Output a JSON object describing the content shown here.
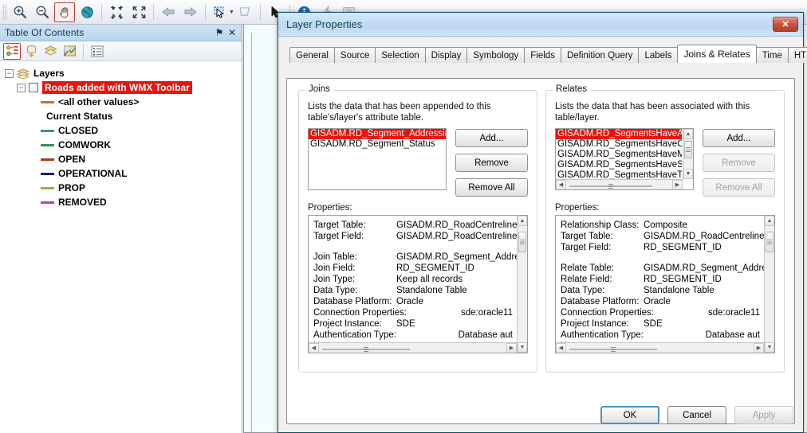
{
  "toolbar": {
    "buttons": [
      {
        "name": "zoom-in-icon",
        "label": "Zoom In",
        "active": false
      },
      {
        "name": "zoom-out-icon",
        "label": "Zoom Out",
        "active": false
      },
      {
        "name": "pan-hand-icon",
        "label": "Pan",
        "active": true
      },
      {
        "name": "full-extent-globe-icon",
        "label": "Full Extent",
        "active": false
      },
      {
        "name": "fixed-zoom-in-icon",
        "label": "Fixed Zoom In",
        "active": false
      },
      {
        "name": "fixed-zoom-out-icon",
        "label": "Fixed Zoom Out",
        "active": false
      },
      {
        "name": "back-extent-arrow-icon",
        "label": "Go Back To Previous Extent",
        "active": false
      },
      {
        "name": "forward-extent-arrow-icon",
        "label": "Go To Next Extent",
        "active": false
      },
      {
        "name": "select-features-icon",
        "label": "Select Features",
        "active": false
      },
      {
        "name": "clear-selection-icon",
        "label": "Clear Selected Features",
        "active": false
      },
      {
        "name": "select-elements-arrow-icon",
        "label": "Select Elements",
        "active": false
      },
      {
        "name": "identify-info-icon",
        "label": "Identify",
        "active": false
      },
      {
        "name": "hyperlink-lightning-icon",
        "label": "Hyperlink",
        "active": false
      },
      {
        "name": "html-popup-icon",
        "label": "HTML Popup",
        "active": false
      }
    ]
  },
  "toc": {
    "title": "Table Of Contents",
    "pin_icon": "⚑",
    "close_icon": "✕",
    "tools": [
      {
        "name": "list-by-drawing-order-icon",
        "selected": true
      },
      {
        "name": "list-by-source-icon",
        "selected": false
      },
      {
        "name": "list-by-visibility-icon",
        "selected": false
      },
      {
        "name": "list-by-selection-icon",
        "selected": false
      },
      {
        "name": "options-icon",
        "selected": false
      }
    ],
    "root": "Layers",
    "layer": "Roads added with WMX Toolbar",
    "legend": [
      {
        "label": "<all other values>",
        "color": "#c8761a",
        "type": "line"
      },
      {
        "label": "Current Status",
        "color": "",
        "type": "heading"
      },
      {
        "label": "CLOSED",
        "color": "#3e8a9c",
        "type": "line"
      },
      {
        "label": "COMWORK",
        "color": "#2f8f63",
        "type": "line"
      },
      {
        "label": "OPEN",
        "color": "#a23c21",
        "type": "line"
      },
      {
        "label": "OPERATIONAL",
        "color": "#17246e",
        "type": "line"
      },
      {
        "label": "PROP",
        "color": "#97b628",
        "type": "line"
      },
      {
        "label": "REMOVED",
        "color": "#b440b8",
        "type": "line"
      }
    ]
  },
  "dialog": {
    "title": "Layer Properties",
    "close_label": "✕",
    "tabs": [
      {
        "label": "General",
        "active": false
      },
      {
        "label": "Source",
        "active": false
      },
      {
        "label": "Selection",
        "active": false
      },
      {
        "label": "Display",
        "active": false
      },
      {
        "label": "Symbology",
        "active": false
      },
      {
        "label": "Fields",
        "active": false
      },
      {
        "label": "Definition Query",
        "active": false
      },
      {
        "label": "Labels",
        "active": false
      },
      {
        "label": "Joins & Relates",
        "active": true
      },
      {
        "label": "Time",
        "active": false
      },
      {
        "label": "HTML Popup",
        "active": false
      }
    ],
    "joins": {
      "legend": "Joins",
      "description": "Lists the data that has been appended to this table's/layer's attribute table.",
      "items": [
        {
          "label": "GISADM.RD_Segment_Addressing",
          "selected": true
        },
        {
          "label": "GISADM.RD_Segment_Status",
          "selected": false
        }
      ],
      "buttons": [
        {
          "label": "Add...",
          "name": "add-join-button",
          "disabled": false
        },
        {
          "label": "Remove",
          "name": "remove-join-button",
          "disabled": false
        },
        {
          "label": "Remove All",
          "name": "remove-all-joins-button",
          "disabled": false
        }
      ],
      "properties_label": "Properties:",
      "properties": [
        {
          "key": "Target Table:",
          "value": "GISADM.RD_RoadCentrelines",
          "align": "left"
        },
        {
          "key": "Target Field:",
          "value": "GISADM.RD_RoadCentrelines.RD",
          "align": "left"
        },
        {
          "key": "",
          "value": "",
          "align": "gap"
        },
        {
          "key": "Join Table:",
          "value": "GISADM.RD_Segment_Addressing",
          "align": "left"
        },
        {
          "key": "Join Field:",
          "value": "RD_SEGMENT_ID",
          "align": "left"
        },
        {
          "key": "Join Type:",
          "value": "Keep all records",
          "align": "left"
        },
        {
          "key": "Data Type:",
          "value": "Standalone Table",
          "align": "left"
        },
        {
          "key": "Database Platform:",
          "value": "Oracle",
          "align": "left"
        },
        {
          "key": "Connection Properties:",
          "value": "sde:oracle11",
          "align": "right"
        },
        {
          "key": "Project Instance:",
          "value": "SDE",
          "align": "left"
        },
        {
          "key": "Authentication Type:",
          "value": "Database aut",
          "align": "right"
        },
        {
          "key": "User name:",
          "value": "",
          "align": "left"
        }
      ]
    },
    "relates": {
      "legend": "Relates",
      "description": "Lists the data that has been associated with this table/layer.",
      "items": [
        {
          "label": "GISADM.RD_SegmentsHaveAddres",
          "selected": true
        },
        {
          "label": "GISADM.RD_SegmentsHaveClassif",
          "selected": false
        },
        {
          "label": "GISADM.RD_SegmentsHaveMaintC",
          "selected": false
        },
        {
          "label": "GISADM.RD_SegmentsHaveStatus",
          "selected": false
        },
        {
          "label": "GISADM.RD_SegmentsHaveTruckR",
          "selected": false
        }
      ],
      "buttons": [
        {
          "label": "Add...",
          "name": "add-relate-button",
          "disabled": false
        },
        {
          "label": "Remove",
          "name": "remove-relate-button",
          "disabled": true
        },
        {
          "label": "Remove All",
          "name": "remove-all-relates-button",
          "disabled": true
        }
      ],
      "properties_label": "Properties:",
      "properties": [
        {
          "key": "Relationship Class:",
          "value": "Composite",
          "align": "left"
        },
        {
          "key": "Target Table:",
          "value": "GISADM.RD_RoadCentrelines",
          "align": "left"
        },
        {
          "key": "Target Field:",
          "value": "RD_SEGMENT_ID",
          "align": "left"
        },
        {
          "key": "",
          "value": "",
          "align": "gap"
        },
        {
          "key": "Relate Table:",
          "value": "GISADM.RD_Segment_Addressing",
          "align": "left"
        },
        {
          "key": "Relate Field:",
          "value": "RD_SEGMENT_ID",
          "align": "left"
        },
        {
          "key": "Data Type:",
          "value": "Standalone Table",
          "align": "left"
        },
        {
          "key": "Database Platform:",
          "value": "Oracle",
          "align": "left"
        },
        {
          "key": "Connection Properties:",
          "value": "sde:oracle11",
          "align": "right"
        },
        {
          "key": "Project Instance:",
          "value": "SDE",
          "align": "left"
        },
        {
          "key": "Authentication Type:",
          "value": "Database aut",
          "align": "right"
        },
        {
          "key": "User name:",
          "value": "",
          "align": "left"
        }
      ]
    },
    "footer": [
      {
        "label": "OK",
        "name": "ok-button",
        "style": "default"
      },
      {
        "label": "Cancel",
        "name": "cancel-button",
        "style": "normal"
      },
      {
        "label": "Apply",
        "name": "apply-button",
        "style": "disabled"
      }
    ]
  },
  "colors": {
    "selection_red": "#e8130b",
    "titlebar_blue": "#bcd9f0",
    "toc_header": "#cfe2f3"
  }
}
